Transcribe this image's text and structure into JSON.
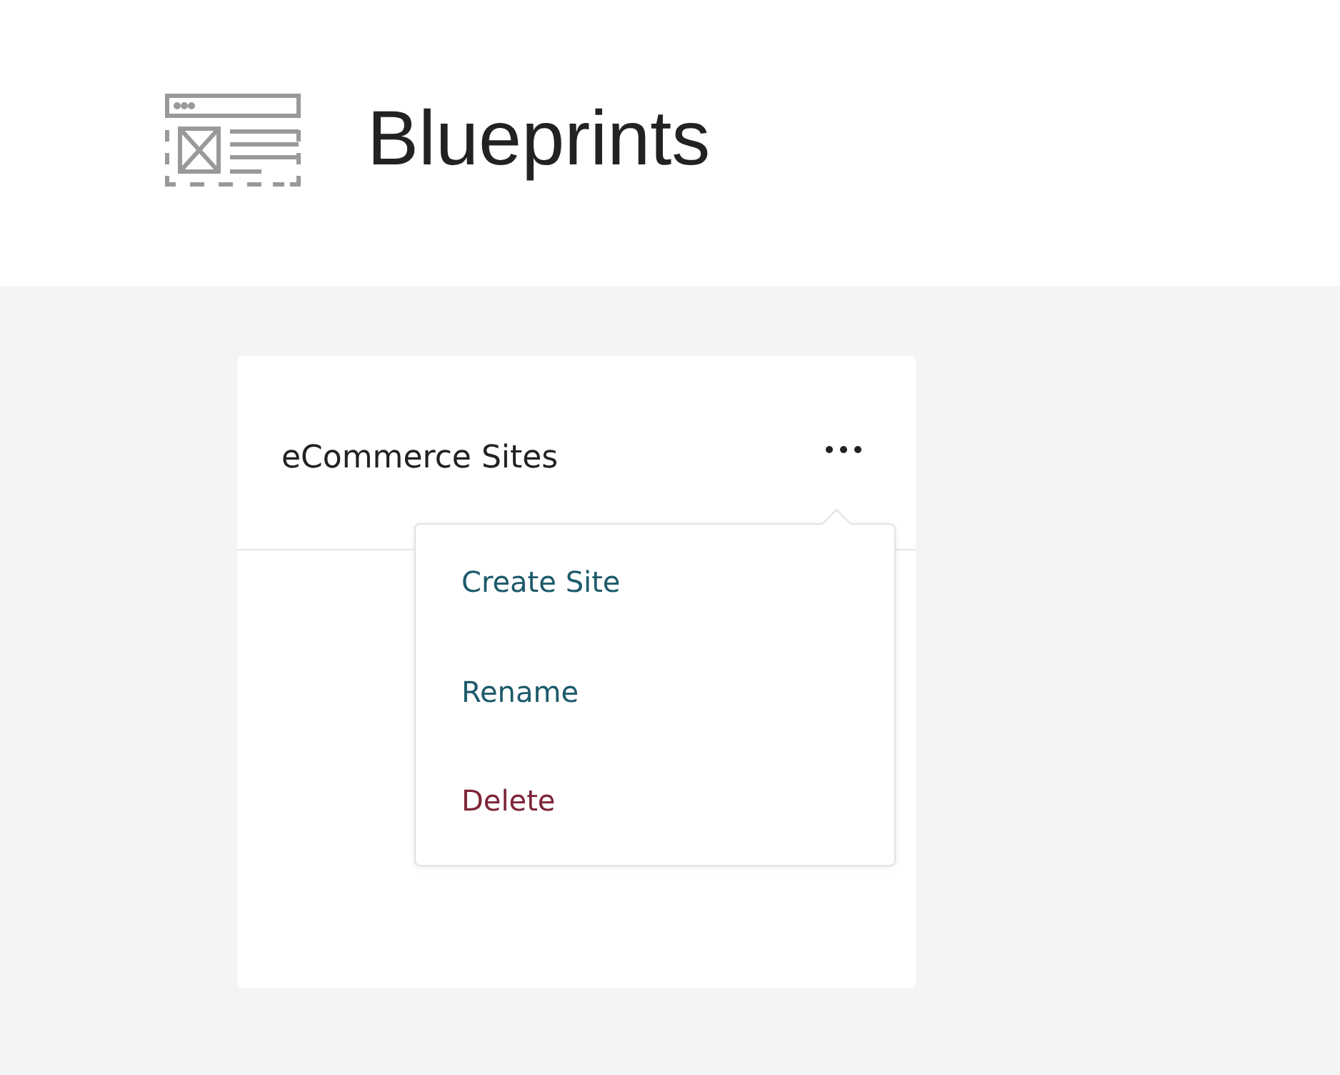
{
  "header": {
    "title": "Blueprints"
  },
  "card": {
    "title": "eCommerce Sites"
  },
  "menu": {
    "items": [
      {
        "label": "Create Site",
        "kind": "normal"
      },
      {
        "label": "Rename",
        "kind": "normal"
      },
      {
        "label": "Delete",
        "kind": "danger"
      }
    ]
  }
}
